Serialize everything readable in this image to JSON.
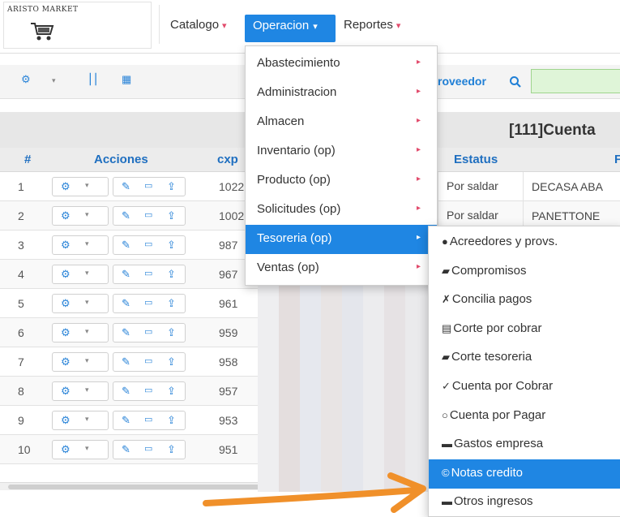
{
  "logo": {
    "text": "ARISTO MARKET",
    "icon": "cart-icon"
  },
  "nav": {
    "catalogo": "Catalogo",
    "operacion": "Operacion",
    "reportes": "Reportes",
    "caret": "▾"
  },
  "toolbar": {
    "proveedor_label": "roveedor",
    "search_icon": "search-icon"
  },
  "table": {
    "title": "[111]Cuenta",
    "headers": {
      "num": "#",
      "acciones": "Acciones",
      "cxp": "cxp",
      "estatus": "Estatus",
      "prov": "F"
    },
    "rows": [
      {
        "num": "1",
        "cxp": "1022",
        "estatus": "Por saldar",
        "prov": "DECASA ABA"
      },
      {
        "num": "2",
        "cxp": "1002",
        "estatus": "Por saldar",
        "prov": "PANETTONE"
      },
      {
        "num": "3",
        "cxp": "987",
        "estatus": "",
        "prov": ""
      },
      {
        "num": "4",
        "cxp": "967",
        "estatus": "",
        "prov": ""
      },
      {
        "num": "5",
        "cxp": "961",
        "estatus": "",
        "prov": ""
      },
      {
        "num": "6",
        "cxp": "959",
        "estatus": "",
        "prov": ""
      },
      {
        "num": "7",
        "cxp": "958",
        "estatus": "",
        "prov": ""
      },
      {
        "num": "8",
        "cxp": "957",
        "estatus": "",
        "prov": ""
      },
      {
        "num": "9",
        "cxp": "953",
        "estatus": "",
        "prov": ""
      },
      {
        "num": "10",
        "cxp": "951",
        "estatus": "",
        "prov": ""
      }
    ]
  },
  "menu": {
    "items": [
      {
        "label": "Abastecimiento"
      },
      {
        "label": "Administracion"
      },
      {
        "label": "Almacen"
      },
      {
        "label": "Inventario (op)"
      },
      {
        "label": "Producto (op)"
      },
      {
        "label": "Solicitudes (op)"
      },
      {
        "label": "Tesoreria (op)"
      },
      {
        "label": "Ventas (op)"
      }
    ],
    "arrow": "▸"
  },
  "submenu": {
    "items": [
      {
        "icon": "●",
        "label": "Acreedores y provs."
      },
      {
        "icon": "▰",
        "label": "Compromisos"
      },
      {
        "icon": "✗",
        "label": "Concilia pagos"
      },
      {
        "icon": "▤",
        "label": "Corte por cobrar"
      },
      {
        "icon": "▰",
        "label": "Corte tesoreria"
      },
      {
        "icon": "✓",
        "label": "Cuenta por Cobrar"
      },
      {
        "icon": "○",
        "label": "Cuenta por Pagar"
      },
      {
        "icon": "▬",
        "label": "Gastos empresa"
      },
      {
        "icon": "©",
        "label": "Notas credito"
      },
      {
        "icon": "▬",
        "label": "Otros ingresos"
      }
    ]
  },
  "colors": {
    "accent": "#1f86e3",
    "caret": "#e24b6c",
    "annotation": "#f0902a"
  }
}
